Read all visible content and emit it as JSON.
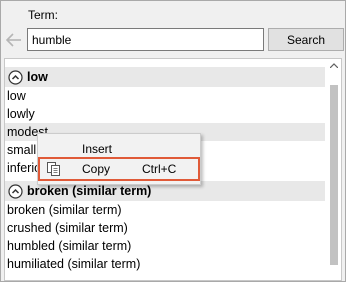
{
  "search": {
    "term_label": "Term:",
    "value": "humble",
    "button_label": "Search"
  },
  "groups": [
    {
      "title": "low",
      "items": [
        "low",
        "lowly",
        "modest",
        "small",
        "inferior"
      ]
    },
    {
      "title": "broken (similar term)",
      "items": [
        "broken (similar term)",
        "crushed (similar term)",
        "humbled (similar term)",
        "humiliated (similar term)"
      ]
    }
  ],
  "context_menu": {
    "insert_label": "Insert",
    "copy_label": "Copy",
    "copy_shortcut": "Ctrl+C"
  },
  "colors": {
    "highlight_border": "#e05a38",
    "header_bg": "#e8e8e8"
  },
  "icons": {
    "back": "back-arrow-icon",
    "collapse": "collapse-circle-icon",
    "copy": "copy-icon"
  }
}
